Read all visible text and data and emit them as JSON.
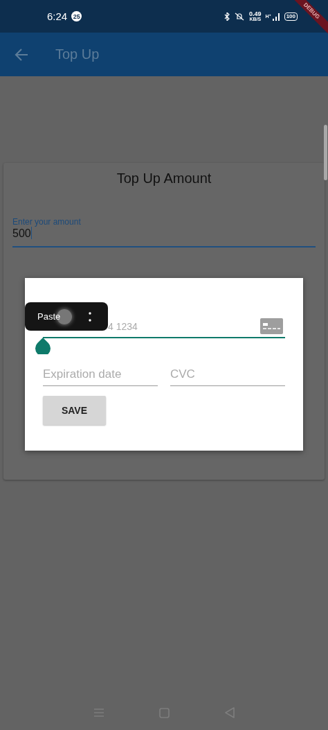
{
  "status_bar": {
    "time": "6:24",
    "notification_count": "25",
    "speed_value": "0.49",
    "speed_unit": "KB/S",
    "network": "H⁺",
    "battery": "100"
  },
  "debug_banner": {
    "label": "DEBUG"
  },
  "app_bar": {
    "title": "Top Up"
  },
  "card": {
    "title": "Top Up Amount",
    "amount_field": {
      "label": "Enter your amount",
      "value": "500",
      "focused": true
    }
  },
  "dialog": {
    "card_number_field": {
      "placeholder": "4 1234",
      "focused": true
    },
    "expiry_field": {
      "placeholder": "Expiration date"
    },
    "cvc_field": {
      "placeholder": "CVC"
    },
    "save_button": {
      "label": "SAVE"
    }
  },
  "text_toolbar": {
    "paste": "Paste"
  }
}
